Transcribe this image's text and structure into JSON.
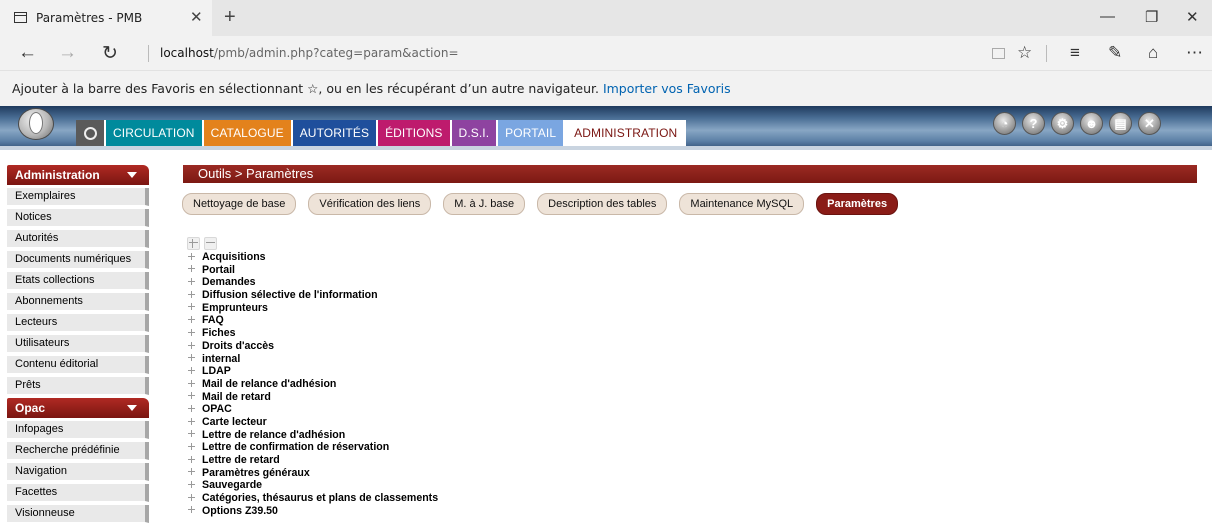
{
  "browser": {
    "tab_title": "Paramètres - PMB",
    "url_host": "localhost",
    "url_path": "/pmb/admin.php?categ=param&action=",
    "favorites_text": "Ajouter à la barre des Favoris en sélectionnant ☆, ou en les récupérant d’un autre navigateur.",
    "favorites_link": "Importer vos Favoris"
  },
  "menu": {
    "items": [
      "CIRCULATION",
      "CATALOGUE",
      "AUTORITÉS",
      "ÉDITIONS",
      "D.S.I.",
      "PORTAIL",
      "ADMINISTRATION"
    ],
    "active": "ADMINISTRATION"
  },
  "sidebar": {
    "section1": "Administration",
    "items1": [
      "Exemplaires",
      "Notices",
      "Autorités",
      "Documents numériques",
      "Etats collections",
      "Abonnements",
      "Lecteurs",
      "Utilisateurs",
      "Contenu éditorial",
      "Prêts"
    ],
    "section2": "Opac",
    "items2": [
      "Infopages",
      "Recherche prédéfinie",
      "Navigation",
      "Facettes",
      "Visionneuse"
    ]
  },
  "content": {
    "breadcrumb": "Outils > Paramètres",
    "subtabs": [
      "Nettoyage de base",
      "Vérification des liens",
      "M. à J. base",
      "Description des tables",
      "Maintenance MySQL",
      "Paramètres"
    ],
    "active_subtab": "Paramètres",
    "tree": [
      "Acquisitions",
      "Portail",
      "Demandes",
      "Diffusion sélective de l'information",
      "Emprunteurs",
      "FAQ",
      "Fiches",
      "Droits d'accès",
      "internal",
      "LDAP",
      "Mail de relance d'adhésion",
      "Mail de retard",
      "OPAC",
      "Carte lecteur",
      "Lettre de relance d'adhésion",
      "Lettre de confirmation de réservation",
      "Lettre de retard",
      "Paramètres généraux",
      "Sauvegarde",
      "Catégories, thésaurus et plans de classements",
      "Options Z39.50"
    ]
  },
  "colors": {
    "accent": "#7a1511",
    "circulation": "#008a9c",
    "catalogue": "#e3821c",
    "autorites": "#1f4f9c",
    "editions": "#be1b6d",
    "dsi": "#8e43a0",
    "portail": "#7aa6e1"
  }
}
